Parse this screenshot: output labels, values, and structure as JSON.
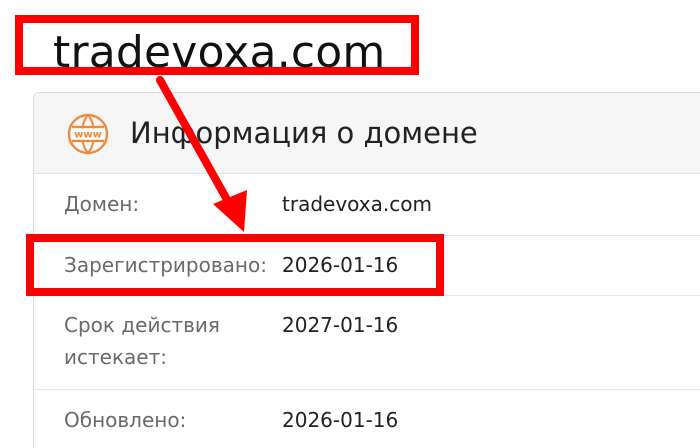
{
  "callout": {
    "domain_text": "tradevoxa.com"
  },
  "card": {
    "icon": "www-globe-icon",
    "icon_text": "www",
    "title": "Информация о домене"
  },
  "rows": [
    {
      "label": "Домен:",
      "value": "tradevoxa.com"
    },
    {
      "label": "Зарегистрировано:",
      "value": "2026-01-16"
    },
    {
      "label": "Срок действия истекает:",
      "value": "2027-01-16"
    },
    {
      "label": "Обновлено:",
      "value": "2026-01-16"
    }
  ],
  "colors": {
    "highlight": "#ff0000",
    "icon_orange": "#f08a3c"
  }
}
